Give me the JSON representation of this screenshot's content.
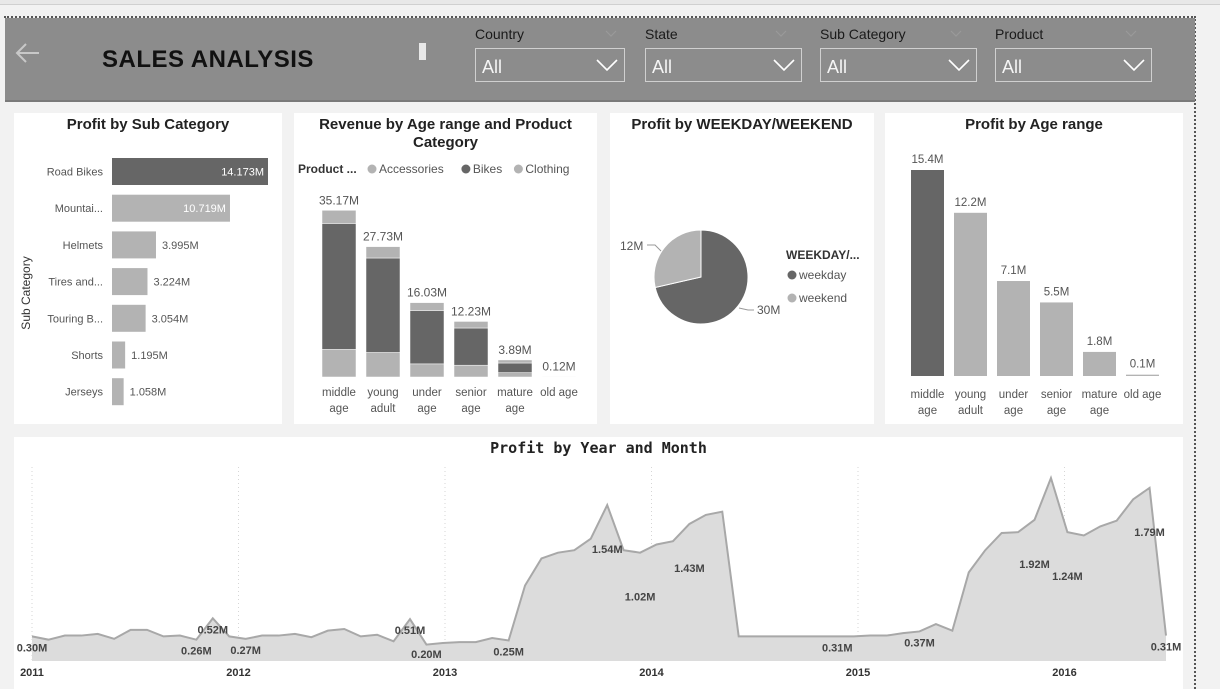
{
  "header": {
    "title": "SALES ANALYSIS",
    "back_icon": "arrow-left-icon",
    "slicers": [
      {
        "label": "Country",
        "value": "All"
      },
      {
        "label": "State",
        "value": "All"
      },
      {
        "label": "Sub Category",
        "value": "All"
      },
      {
        "label": "Product",
        "value": "All"
      }
    ]
  },
  "colors": {
    "header_bg": "#8c8c8c",
    "dark": "#666666",
    "light": "#b3b3b3",
    "area": "#dcdcdc"
  },
  "chart_data": [
    {
      "type": "bar",
      "orientation": "horizontal",
      "title": "Profit by Sub Category",
      "ylabel": "Sub Category",
      "categories": [
        "Road Bikes",
        "Mountai...",
        "Helmets",
        "Tires and...",
        "Touring B...",
        "Shorts",
        "Jerseys"
      ],
      "values": [
        14.173,
        10.719,
        3.995,
        3.224,
        3.054,
        1.195,
        1.058
      ],
      "value_labels": [
        "14.173M",
        "10.719M",
        "3.995M",
        "3.224M",
        "3.054M",
        "1.195M",
        "1.058M"
      ]
    },
    {
      "type": "bar",
      "stacked": true,
      "title": "Revenue by Age range and Product Category",
      "legend_title": "Product ...",
      "legend_position": "top",
      "categories": [
        "middle age",
        "young adult",
        "under age",
        "senior age",
        "mature age",
        "old age"
      ],
      "series": [
        {
          "name": "Accessories",
          "values": [
            6.3,
            5.6,
            3.0,
            2.7,
            1.0,
            0.12
          ]
        },
        {
          "name": "Bikes",
          "values": [
            28.8,
            21.6,
            12.2,
            8.5,
            2.2,
            0.0
          ]
        },
        {
          "name": "Clothing",
          "values": [
            3.0,
            2.6,
            1.8,
            1.5,
            0.7,
            0.0
          ]
        }
      ],
      "totals": [
        "35.17M",
        "27.73M",
        "16.03M",
        "12.23M",
        "3.89M",
        "0.12M"
      ]
    },
    {
      "type": "pie",
      "title": "Profit by WEEKDAY/WEEKEND",
      "legend_title": "WEEKDAY/...",
      "legend_position": "right",
      "labels": [
        "weekday",
        "weekend"
      ],
      "values": [
        30,
        12
      ],
      "value_labels": [
        "30M",
        "12M"
      ]
    },
    {
      "type": "bar",
      "title": "Profit by Age range",
      "categories": [
        "middle age",
        "young adult",
        "under age",
        "senior age",
        "mature age",
        "old age"
      ],
      "values": [
        15.4,
        12.2,
        7.1,
        5.5,
        1.8,
        0.1
      ],
      "value_labels": [
        "15.4M",
        "12.2M",
        "7.1M",
        "5.5M",
        "1.8M",
        "0.1M"
      ]
    },
    {
      "type": "area",
      "title": "Profit by Year and Month",
      "x_ticks": [
        "2011",
        "2012",
        "2013",
        "2014",
        "2015",
        "2016"
      ],
      "values": [
        0.3,
        0.26,
        0.31,
        0.31,
        0.33,
        0.27,
        0.38,
        0.38,
        0.3,
        0.31,
        0.26,
        0.52,
        0.3,
        0.27,
        0.31,
        0.31,
        0.33,
        0.29,
        0.37,
        0.39,
        0.3,
        0.32,
        0.24,
        0.51,
        0.2,
        0.22,
        0.23,
        0.23,
        0.28,
        0.25,
        0.92,
        1.25,
        1.32,
        1.35,
        1.49,
        1.9,
        1.35,
        1.32,
        1.42,
        1.46,
        1.67,
        1.78,
        1.82,
        0.3,
        0.3,
        0.3,
        0.3,
        0.3,
        0.3,
        0.3,
        0.3,
        0.31,
        0.31,
        0.34,
        0.36,
        0.45,
        0.37,
        1.08,
        1.35,
        1.56,
        1.57,
        1.72,
        2.23,
        1.57,
        1.53,
        1.64,
        1.71,
        1.97,
        2.11,
        0.31
      ],
      "annotations": [
        {
          "index": 0,
          "label": "0.30M"
        },
        {
          "index": 11,
          "label": "0.52M"
        },
        {
          "index": 10,
          "label": "0.26M"
        },
        {
          "index": 13,
          "label": "0.27M"
        },
        {
          "index": 23,
          "label": "0.51M"
        },
        {
          "index": 24,
          "label": "0.20M"
        },
        {
          "index": 29,
          "label": "0.25M"
        },
        {
          "index": 35,
          "label": "1.54M"
        },
        {
          "index": 37,
          "label": "1.02M"
        },
        {
          "index": 40,
          "label": "1.43M"
        },
        {
          "index": 49,
          "label": "0.31M"
        },
        {
          "index": 54,
          "label": "0.37M"
        },
        {
          "index": 61,
          "label": "1.92M"
        },
        {
          "index": 63,
          "label": "1.24M"
        },
        {
          "index": 68,
          "label": "1.79M"
        },
        {
          "index": 69,
          "label": "0.31M"
        }
      ]
    }
  ]
}
